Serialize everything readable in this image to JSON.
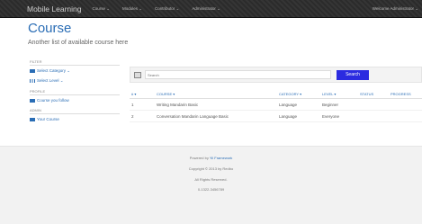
{
  "navbar": {
    "brand": "Mobile Learning",
    "menu": [
      "Course ⌄",
      "Modules ⌄",
      "Contributor ⌄",
      "Administrator ⌄"
    ],
    "welcome": "Welcome Administrator ⌄"
  },
  "page": {
    "title": "Course",
    "subtitle": "Another list of available course here"
  },
  "sidebar": {
    "filter": {
      "heading": "FILTER",
      "items": [
        "Select Category ⌄",
        "Select Level ⌄"
      ]
    },
    "profile": {
      "heading": "PROFILE",
      "items": [
        "Course you follow"
      ]
    },
    "admin": {
      "heading": "ADMIN",
      "items": [
        "Your Course"
      ]
    }
  },
  "search": {
    "placeholder": "Search",
    "button_label": "Search"
  },
  "table": {
    "headers": {
      "num": "# ▾",
      "course": "COURSE ▾",
      "category": "CATEGORY ▾",
      "level": "LEVEL ▾",
      "status": "STATUS",
      "progress": "PROGRESS"
    },
    "rows": [
      {
        "num": "1",
        "course": "Writing Mandarin Basic",
        "category": "Language",
        "level": "Beginner",
        "status": "",
        "progress": ""
      },
      {
        "num": "2",
        "course": "Conversation Mandarin Language Basic",
        "category": "Language",
        "level": "Everyone",
        "status": "",
        "progress": ""
      }
    ]
  },
  "footer": {
    "powered_prefix": "Powered by",
    "powered_link": "Yii Framework",
    "copyright": "Copyright © 2013 by Redbo",
    "rights": "All Rights Reserved.",
    "phone": "0-1322-3456789"
  }
}
